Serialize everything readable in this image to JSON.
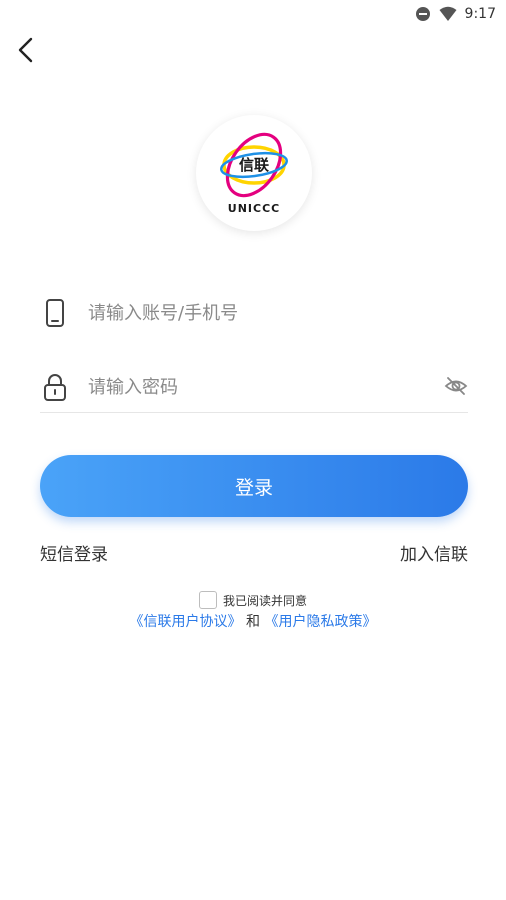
{
  "status_bar": {
    "time": "9:17"
  },
  "logo": {
    "mark_text": "信联",
    "brand_text": "UNICCC"
  },
  "form": {
    "account_placeholder": "请输入账号/手机号",
    "password_placeholder": "请输入密码",
    "login_label": "登录"
  },
  "links": {
    "sms_login": "短信登录",
    "join": "加入信联"
  },
  "agreement": {
    "text": "我已阅读并同意",
    "user_agreement": "《信联用户协议》",
    "and": "和",
    "privacy_policy": "《用户隐私政策》"
  },
  "colors": {
    "accent": "#2b7ae8",
    "accent_light": "#4aa3f8"
  }
}
